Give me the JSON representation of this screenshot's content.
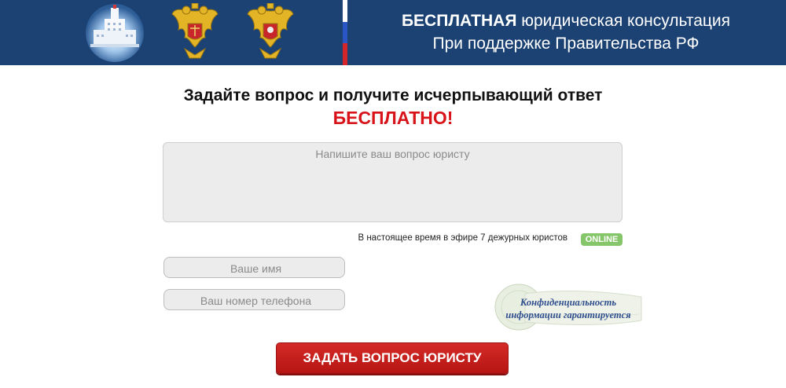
{
  "header": {
    "title_bold": "БЕСПЛАТНАЯ",
    "title_rest": " юридическая консультация",
    "subtitle": "При поддержке Правительства РФ"
  },
  "main": {
    "title": "Задайте вопрос и получите исчерпывающий ответ",
    "title_free": "БЕСПЛАТНО!",
    "question_placeholder": "Напишите ваш вопрос юристу",
    "online_text": "В настоящее время в эфире 7 дежурных юристов",
    "online_badge": "ONLINE",
    "name_placeholder": "Ваше имя",
    "phone_placeholder": "Ваш номер телефона",
    "confidential_line1": "Конфиденциальность",
    "confidential_line2": "информации гарантируется",
    "submit_label": "ЗАДАТЬ ВОПРОС ЮРИСТУ"
  },
  "colors": {
    "header_bg": "#1c4274",
    "accent_red": "#d8131a",
    "online_green": "#86c66a"
  }
}
